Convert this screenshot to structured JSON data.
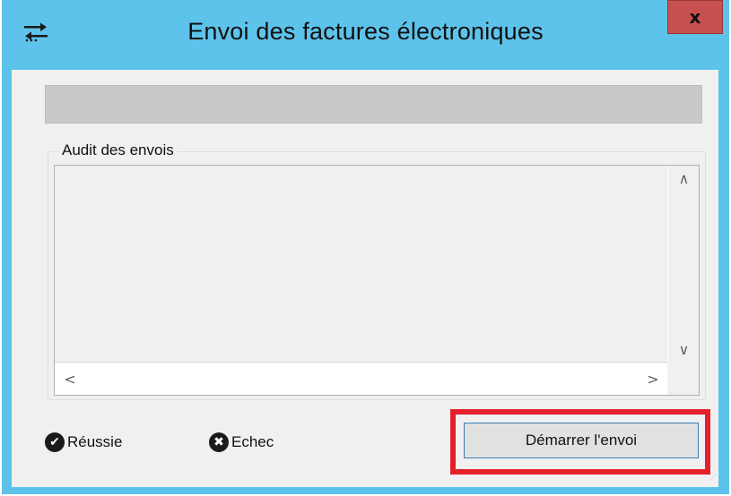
{
  "window": {
    "title": "Envoi des factures électroniques",
    "close_label": "x",
    "icon": "transfer-arrows-icon"
  },
  "progress": {
    "value_percent": 0,
    "color": "#06b025"
  },
  "audit": {
    "label": "Audit des envois",
    "entries": []
  },
  "scrollbar": {
    "up": "∧",
    "down": "∨",
    "left": "<",
    "right": ">"
  },
  "legend": {
    "success": {
      "label": "Réussie",
      "icon": "check-circle-icon"
    },
    "failure": {
      "label": "Echec",
      "icon": "x-circle-icon"
    }
  },
  "actions": {
    "start_label": "Démarrer l'envoi"
  },
  "colors": {
    "titlebar": "#5ec3ea",
    "close_button": "#c75050",
    "highlight": "#e4202a"
  }
}
